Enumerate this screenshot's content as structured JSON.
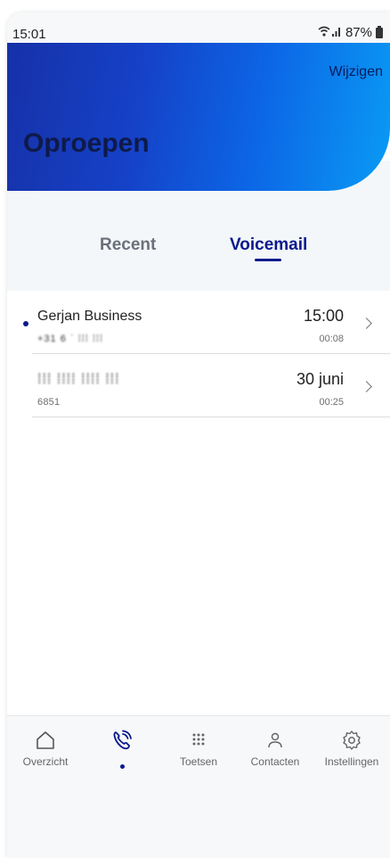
{
  "status_bar": {
    "time": "15:01",
    "battery": "87%"
  },
  "header": {
    "edit_label": "Wijzigen",
    "title": "Oproepen"
  },
  "tabs": [
    {
      "label": "Recent",
      "active": false
    },
    {
      "label": "Voicemail",
      "active": true
    }
  ],
  "voicemails": [
    {
      "name": "Gerjan Business",
      "number": "+31 6 ˈ ⁞⁞⁞ ⁞⁞⁞",
      "time": "15:00",
      "duration": "00:08",
      "unread": true
    },
    {
      "name": "⁞⁞⁞ ⁞⁞⁞⁞ ⁞⁞⁞⁞ ⁞⁞⁞",
      "number": "6851",
      "time": "30 juni",
      "duration": "00:25",
      "unread": false
    }
  ],
  "bottom_nav": [
    {
      "label": "Overzicht",
      "icon": "home-icon",
      "active": false
    },
    {
      "label": "",
      "icon": "phone-call-icon",
      "active": true
    },
    {
      "label": "Toetsen",
      "icon": "keypad-icon",
      "active": false
    },
    {
      "label": "Contacten",
      "icon": "person-icon",
      "active": false
    },
    {
      "label": "Instellingen",
      "icon": "gear-icon",
      "active": false
    }
  ],
  "colors": {
    "accent": "#0b1a8c",
    "gradient_start": "#1631a8",
    "gradient_end": "#0a9bf4"
  }
}
